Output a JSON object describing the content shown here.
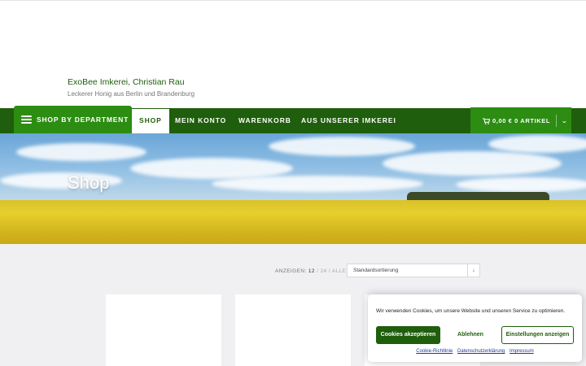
{
  "site": {
    "title": "ExoBee Imkerei, Christian Rau",
    "tagline": "Leckerer Honig aus Berlin und Brandenburg"
  },
  "nav": {
    "department_label": "SHOP BY DEPARTMENT",
    "items": [
      {
        "label": "SHOP",
        "active": true
      },
      {
        "label": "MEIN KONTO"
      },
      {
        "label": "WARENKORB"
      },
      {
        "label": "AUS UNSERER IMKEREI"
      }
    ],
    "cart": {
      "total": "0,00 € 0 ARTIKEL"
    }
  },
  "hero": {
    "title": "Shop"
  },
  "shop": {
    "per_page_label": "ANZEIGEN:",
    "per_page_options": [
      "12",
      "24",
      "ALLE"
    ],
    "sort_selected": "Standardsortierung"
  },
  "cookie": {
    "text": "Wir verwenden Cookies, um unsere Website und unseren Service zu optimieren.",
    "accept_label": "Cookies akzeptieren",
    "deny_label": "Ablehnen",
    "settings_label": "Einstellungen anzeigen",
    "links": [
      "Cookie-Richtlinie",
      "Datenschutzerklärung",
      "Impressum"
    ]
  },
  "colors": {
    "primary": "#1f5e0c",
    "accent": "#2c8d12",
    "content_bg": "#f0f0f3"
  }
}
